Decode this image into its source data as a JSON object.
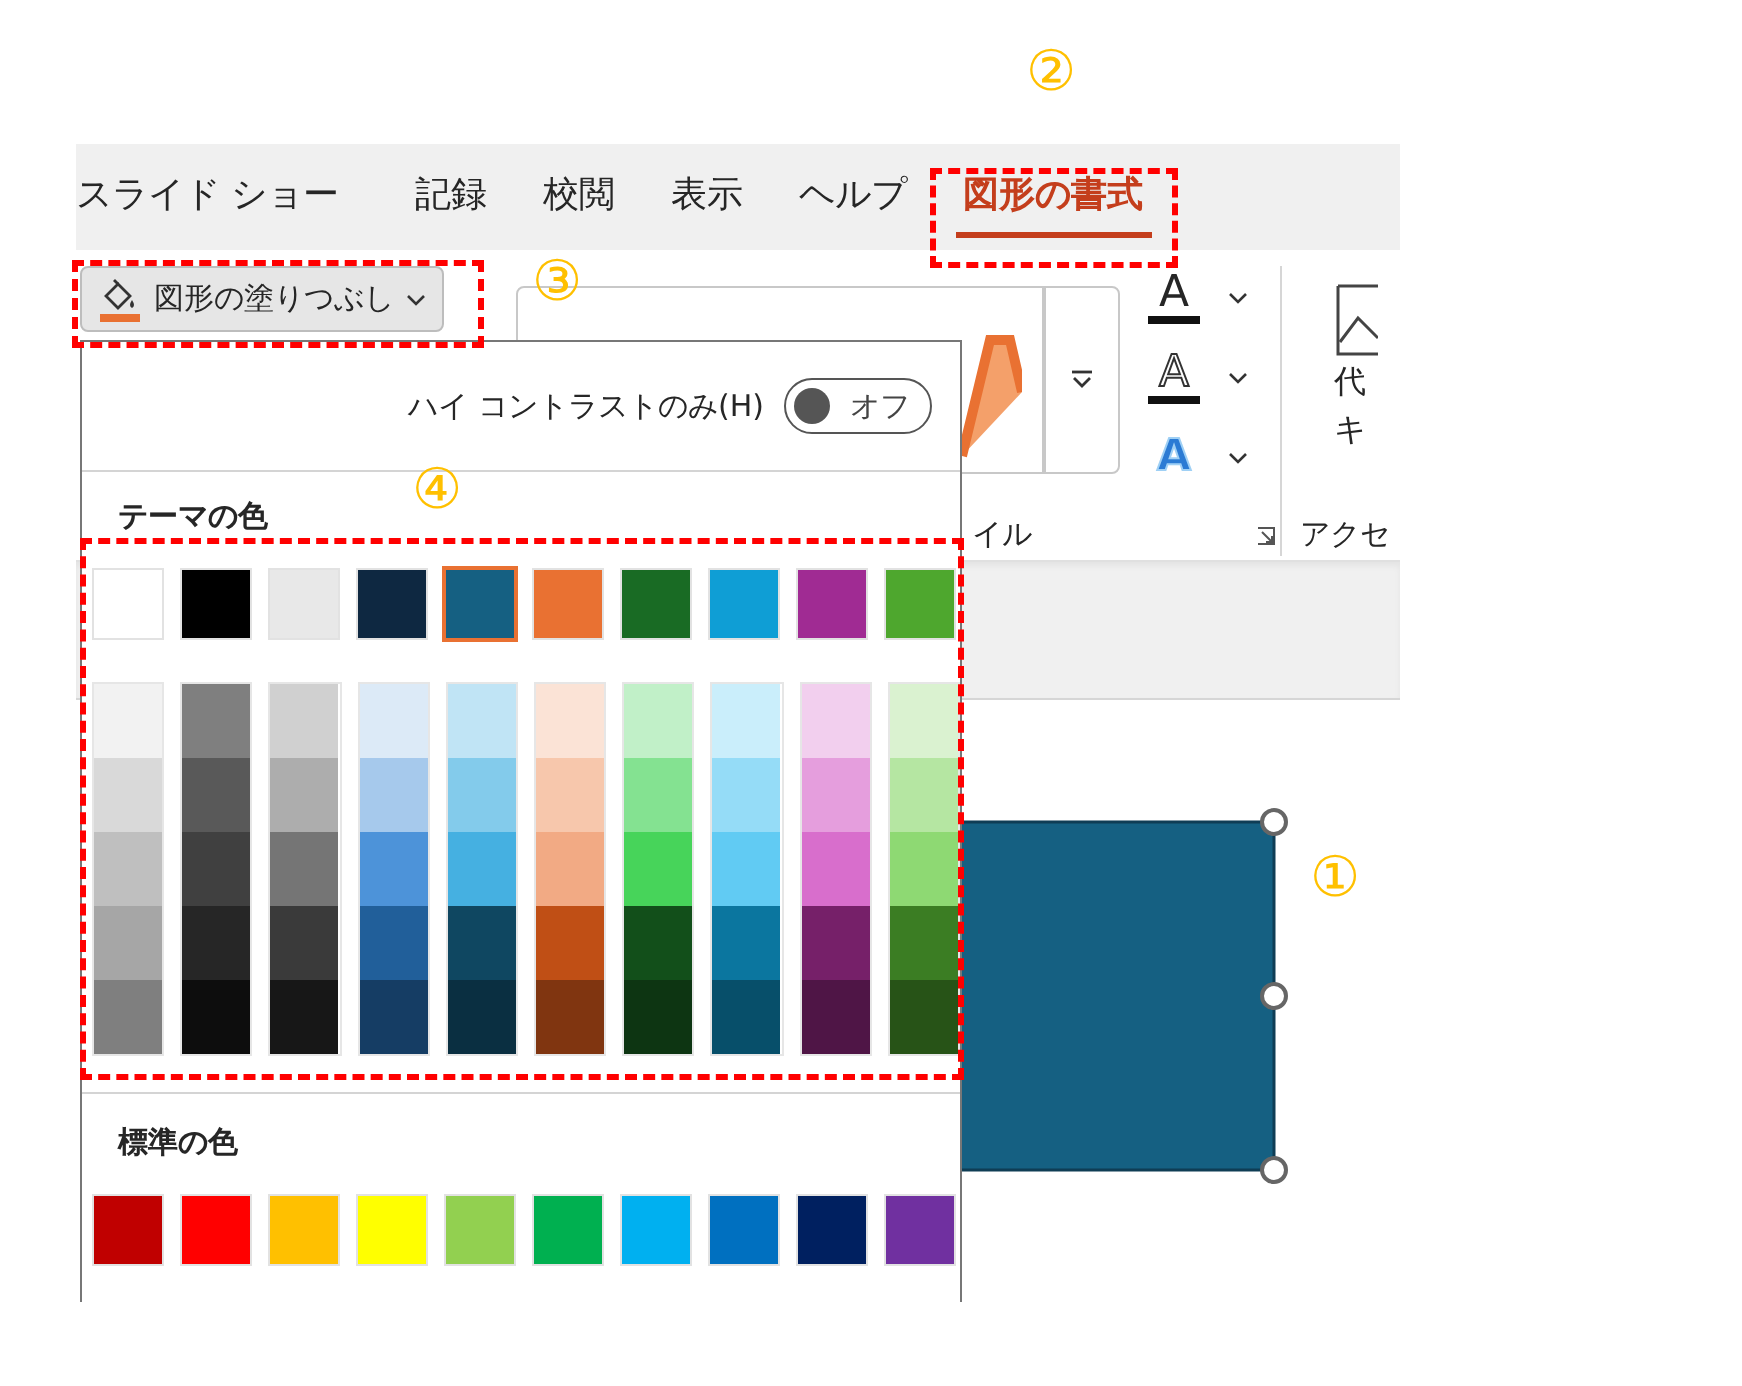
{
  "annotations": [
    {
      "label": "②"
    },
    {
      "label": "③"
    },
    {
      "label": "④"
    },
    {
      "label": "①"
    }
  ],
  "ribbon": {
    "tabs": [
      {
        "label": "スライド ショー",
        "selected": false
      },
      {
        "label": "記録",
        "selected": false
      },
      {
        "label": "校閲",
        "selected": false
      },
      {
        "label": "表示",
        "selected": false
      },
      {
        "label": "ヘルプ",
        "selected": false
      },
      {
        "label": "図形の書式",
        "selected": true
      }
    ],
    "fill_button": {
      "label": "図形の塗りつぶし"
    },
    "text_tools": [
      {
        "kind": "fill",
        "glyph": "A"
      },
      {
        "kind": "outline",
        "glyph": "A"
      },
      {
        "kind": "effects",
        "glyph": "A"
      }
    ],
    "alt_text": [
      "代",
      "キ"
    ],
    "group_labels": [
      "イル",
      "アクセ"
    ]
  },
  "dropdown": {
    "high_contrast": {
      "label": "ハイ コントラストのみ(H)",
      "on": false,
      "state_label": "オフ"
    },
    "theme_heading": "テーマの色",
    "theme_colors": [
      {
        "color": "#ffffff",
        "selected": false
      },
      {
        "color": "#000000",
        "selected": false
      },
      {
        "color": "#e8e8e8",
        "selected": false
      },
      {
        "color": "#0e2841",
        "selected": false
      },
      {
        "color": "#156082",
        "selected": true
      },
      {
        "color": "#e97132",
        "selected": false
      },
      {
        "color": "#196b24",
        "selected": false
      },
      {
        "color": "#0f9ed5",
        "selected": false
      },
      {
        "color": "#a02b93",
        "selected": false
      },
      {
        "color": "#4ea72e",
        "selected": false
      }
    ],
    "shades": [
      {
        "colors": [
          {
            "color": "#f2f2f2"
          },
          {
            "color": "#d9d9d9"
          },
          {
            "color": "#bfbfbf"
          },
          {
            "color": "#a6a6a6"
          },
          {
            "color": "#7f7f7f"
          }
        ]
      },
      {
        "colors": [
          {
            "color": "#7f7f7f"
          },
          {
            "color": "#595959"
          },
          {
            "color": "#404040"
          },
          {
            "color": "#262626"
          },
          {
            "color": "#0d0d0d"
          }
        ]
      },
      {
        "colors": [
          {
            "color": "#d0d0d0"
          },
          {
            "color": "#adadad"
          },
          {
            "color": "#757575"
          },
          {
            "color": "#3a3a3a"
          },
          {
            "color": "#171717"
          }
        ]
      },
      {
        "colors": [
          {
            "color": "#dceaf7"
          },
          {
            "color": "#a6c9ec"
          },
          {
            "color": "#4d93d9"
          },
          {
            "color": "#215f9a"
          },
          {
            "color": "#153d64"
          }
        ]
      },
      {
        "colors": [
          {
            "color": "#c0e4f5"
          },
          {
            "color": "#83cbeb"
          },
          {
            "color": "#45b0e1"
          },
          {
            "color": "#0f4761"
          },
          {
            "color": "#0a2f41"
          }
        ]
      },
      {
        "colors": [
          {
            "color": "#fbe3d6"
          },
          {
            "color": "#f7c7ac"
          },
          {
            "color": "#f2aa84"
          },
          {
            "color": "#c04f15"
          },
          {
            "color": "#803510"
          }
        ]
      },
      {
        "colors": [
          {
            "color": "#c1f0c8"
          },
          {
            "color": "#84e291"
          },
          {
            "color": "#47d45a"
          },
          {
            "color": "#124f1a"
          },
          {
            "color": "#0d3512"
          }
        ]
      },
      {
        "colors": [
          {
            "color": "#caeefb"
          },
          {
            "color": "#95dcf7"
          },
          {
            "color": "#61cbf3"
          },
          {
            "color": "#0b769f"
          },
          {
            "color": "#074f6a"
          }
        ]
      },
      {
        "colors": [
          {
            "color": "#f2cfee"
          },
          {
            "color": "#e59edd"
          },
          {
            "color": "#d86ecc"
          },
          {
            "color": "#762069"
          },
          {
            "color": "#4f1546"
          }
        ]
      },
      {
        "colors": [
          {
            "color": "#daf2d0"
          },
          {
            "color": "#b5e6a2"
          },
          {
            "color": "#8ed973"
          },
          {
            "color": "#3b7d23"
          },
          {
            "color": "#275317"
          }
        ]
      }
    ],
    "standard_heading": "標準の色",
    "standard_colors": [
      {
        "color": "#c00000"
      },
      {
        "color": "#ff0000"
      },
      {
        "color": "#ffc000"
      },
      {
        "color": "#ffff00"
      },
      {
        "color": "#92d050"
      },
      {
        "color": "#00b050"
      },
      {
        "color": "#00b0f0"
      },
      {
        "color": "#0070c0"
      },
      {
        "color": "#002060"
      },
      {
        "color": "#7030a0"
      }
    ]
  },
  "shape": {
    "selected": true
  }
}
